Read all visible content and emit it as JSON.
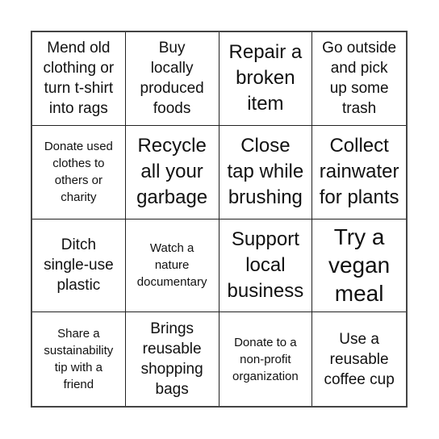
{
  "board": {
    "rows": 4,
    "columns": 4,
    "cells": [
      {
        "text": "Mend old clothing or turn t-shirt into rags",
        "lines": [
          "Mend old",
          "clothing or",
          "turn t-shirt",
          "into rags"
        ],
        "size": "md"
      },
      {
        "text": "Buy locally produced foods",
        "lines": [
          "Buy",
          "locally",
          "produced",
          "foods"
        ],
        "size": "md"
      },
      {
        "text": "Repair a broken item",
        "lines": [
          "Repair a",
          "broken",
          "item"
        ],
        "size": "lg"
      },
      {
        "text": "Go outside and pick up some trash",
        "lines": [
          "Go outside",
          "and pick",
          "up some",
          "trash"
        ],
        "size": "md"
      },
      {
        "text": "Donate used clothes to others or charity",
        "lines": [
          "Donate used",
          "clothes to",
          "others or",
          "charity"
        ],
        "size": "sm"
      },
      {
        "text": "Recycle all your garbage",
        "lines": [
          "Recycle",
          "all your",
          "garbage"
        ],
        "size": "lg"
      },
      {
        "text": "Close tap while brushing",
        "lines": [
          "Close",
          "tap while",
          "brushing"
        ],
        "size": "lg"
      },
      {
        "text": "Collect rainwater for plants",
        "lines": [
          "Collect",
          "rainwater",
          "for plants"
        ],
        "size": "lg"
      },
      {
        "text": "Ditch single-use plastic",
        "lines": [
          "Ditch",
          "single-use",
          "plastic"
        ],
        "size": "md"
      },
      {
        "text": "Watch a nature documentary",
        "lines": [
          "Watch a",
          "nature",
          "documentary"
        ],
        "size": "sm"
      },
      {
        "text": "Support local business",
        "lines": [
          "Support",
          "local",
          "business"
        ],
        "size": "lg"
      },
      {
        "text": "Try a vegan meal",
        "lines": [
          "Try a",
          "vegan",
          "meal"
        ],
        "size": "xl"
      },
      {
        "text": "Share a sustainability tip with a friend",
        "lines": [
          "Share a",
          "sustainability",
          "tip with a",
          "friend"
        ],
        "size": "sm"
      },
      {
        "text": "Brings reusable shopping bags",
        "lines": [
          "Brings",
          "reusable",
          "shopping",
          "bags"
        ],
        "size": "md"
      },
      {
        "text": "Donate to a non-profit organization",
        "lines": [
          "Donate to a",
          "non-profit",
          "organization"
        ],
        "size": "sm"
      },
      {
        "text": "Use a reusable coffee cup",
        "lines": [
          "Use a",
          "reusable",
          "coffee cup"
        ],
        "size": "md"
      }
    ]
  }
}
